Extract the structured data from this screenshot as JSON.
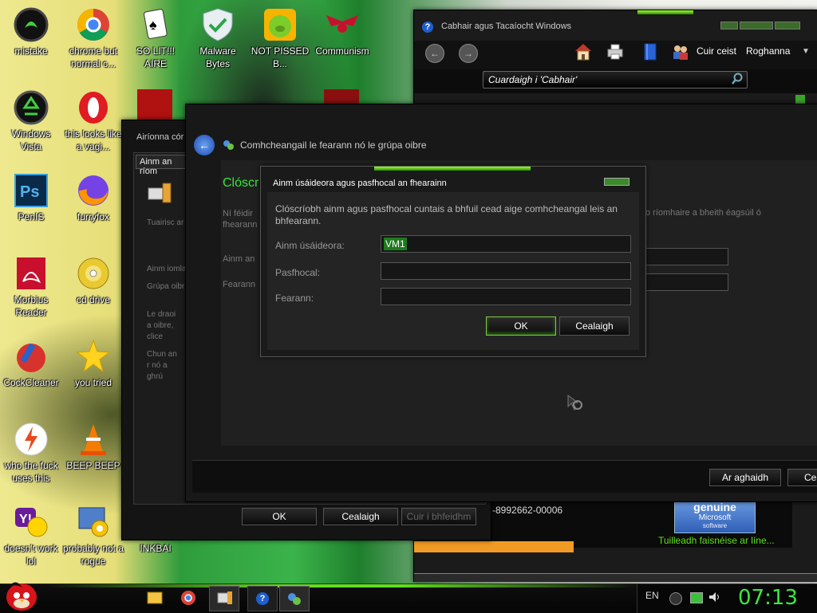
{
  "desktop": {
    "icons": [
      {
        "label": "mistake",
        "icon": "razer-icon"
      },
      {
        "label": "chrome but normal c...",
        "icon": "chrome-icon"
      },
      {
        "label": "SO LIT!!! AIRE",
        "icon": "playing-cards-icon"
      },
      {
        "label": "Malware Bytes",
        "icon": "shield-check-icon"
      },
      {
        "label": "NOT PISSED B...",
        "icon": "angry-pig-icon"
      },
      {
        "label": "Communism",
        "icon": "eagle-icon"
      },
      {
        "label": "Windows Vista",
        "icon": "recycle-bin-icon"
      },
      {
        "label": "this looks like a vagi...",
        "icon": "opera-icon"
      },
      {
        "label": "PenIS",
        "icon": "photoshop-icon"
      },
      {
        "label": "furryfox",
        "icon": "firefox-icon"
      },
      {
        "label": "Morbius Reader",
        "icon": "acrobat-icon"
      },
      {
        "label": "cd drive",
        "icon": "cd-drive-icon"
      },
      {
        "label": "CockCleaner",
        "icon": "ccleaner-icon"
      },
      {
        "label": "you tried",
        "icon": "star-icon"
      },
      {
        "label": "who the fuck uses this",
        "icon": "flash-icon"
      },
      {
        "label": "BEEP BEEP",
        "icon": "vlc-cone-icon"
      },
      {
        "label": "doesn't work lol",
        "icon": "yahoo-messenger-icon"
      },
      {
        "label": "probably not a rogue",
        "icon": "control-panel-icon"
      },
      {
        "label": "INKBAI",
        "icon": "ink-icon"
      }
    ]
  },
  "help_window": {
    "title": "Cabhair agus Tacaíocht Windows",
    "ask_label": "Cuir ceist",
    "options_label": "Roghanna",
    "search_placeholder": "Cuardaigh i 'Cabhair'",
    "product_id": "-8992662-00006",
    "genuine_top": "genuine",
    "genuine_brand": "Microsoft",
    "genuine_sub": "software",
    "more_info": "Tuilleadh faisnéise ar líne..."
  },
  "sysprops_window": {
    "title": "Airíonna cór",
    "tab": "Ainm an ríom",
    "texts": [
      "Tuairisc ar",
      "Ainm iomla",
      "Grúpa oibr",
      "Le draoi a oibre, clice",
      "Chun an r nó a ghrú"
    ],
    "ok": "OK",
    "cancel": "Cealaigh",
    "apply": "Cuir i bhfeidhm"
  },
  "join_window": {
    "title": "Comhcheangail le fearann nó le grúpa oibre",
    "heading": "Clóscr",
    "desc_left": "Ní féidir fhearann",
    "desc_right": "o ríomhaire a bheith éagsúil ó",
    "label_user": "Ainm an",
    "label_domain": "Fearann",
    "next": "Ar aghaidh",
    "cancel_cut": "Cea"
  },
  "cred_dialog": {
    "title": "Ainm úsáideora agus pasfhocal an fhearainn",
    "desc": "Clóscríobh ainm agus pasfhocal cuntais a bhfuil cead aige comhcheangal leis an bhfearann.",
    "username_label": "Ainm úsáideora:",
    "username_value": "VM1",
    "password_label": "Pasfhocal:",
    "domain_label": "Fearann:",
    "ok": "OK",
    "cancel": "Cealaigh"
  },
  "taskbar": {
    "lang": "EN",
    "clock": "07:13"
  },
  "colors": {
    "accent_green": "#5fe01a",
    "heading_green": "#35e83a",
    "clock_green": "#3ee83e"
  }
}
